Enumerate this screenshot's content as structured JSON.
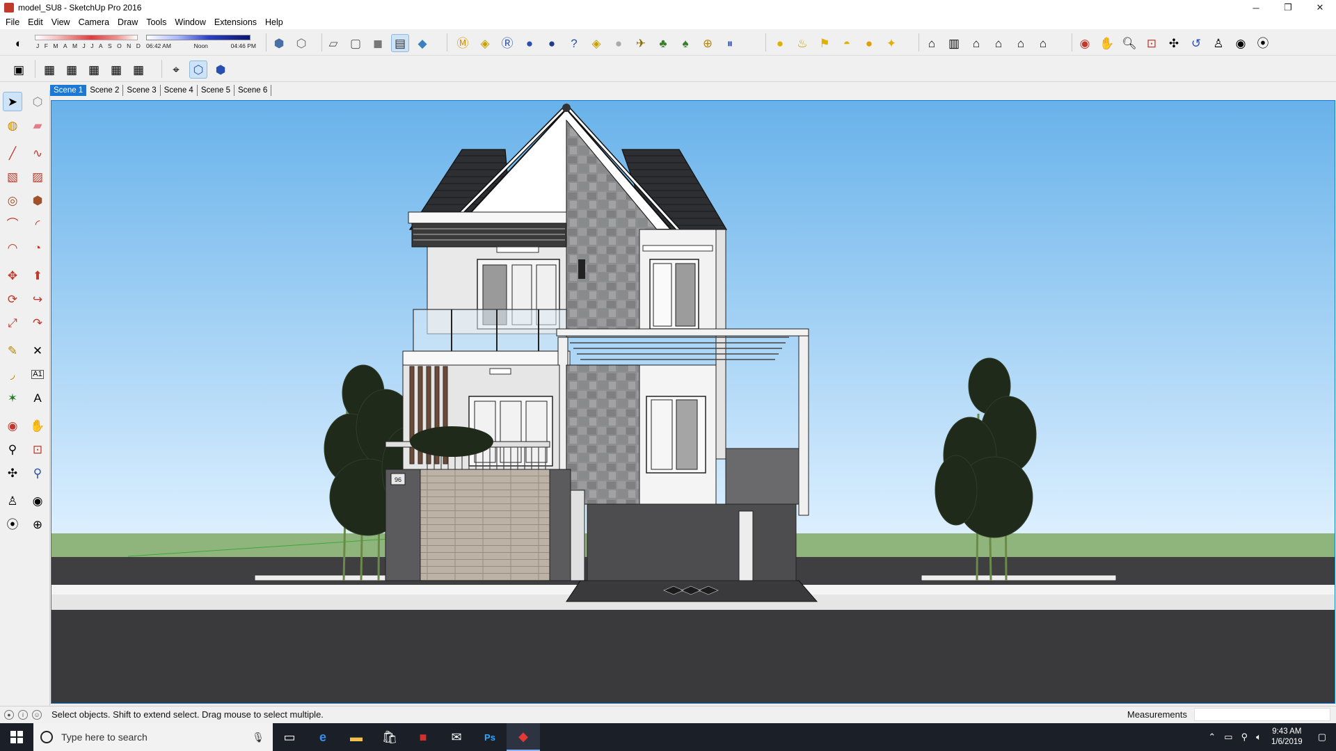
{
  "window": {
    "title": "model_SU8 - SketchUp Pro 2016",
    "controls": {
      "minimize": "─",
      "restore": "❐",
      "close": "✕"
    }
  },
  "menu": [
    "File",
    "Edit",
    "View",
    "Camera",
    "Draw",
    "Tools",
    "Window",
    "Extensions",
    "Help"
  ],
  "shadow": {
    "months": [
      "J",
      "F",
      "M",
      "A",
      "M",
      "J",
      "J",
      "A",
      "S",
      "O",
      "N",
      "D"
    ],
    "time_start": "06:42 AM",
    "time_mid": "Noon",
    "time_end": "04:46 PM"
  },
  "scenes": {
    "tabs": [
      "Scene 1",
      "Scene 2",
      "Scene 3",
      "Scene 4",
      "Scene 5",
      "Scene 6"
    ],
    "active": "Scene 1"
  },
  "status": {
    "hint": "Select objects. Shift to extend select. Drag mouse to select multiple.",
    "measurements_label": "Measurements",
    "measurements_value": ""
  },
  "taskbar": {
    "search_placeholder": "Type here to search",
    "time": "9:43 AM",
    "date": "1/6/2019"
  },
  "model": {
    "house_number": "96"
  },
  "colors": {
    "sky_top": "#6fb6ea",
    "sky_bottom": "#d6ecfa",
    "grass": "#8fb57c",
    "accent": "#1a78d6"
  }
}
